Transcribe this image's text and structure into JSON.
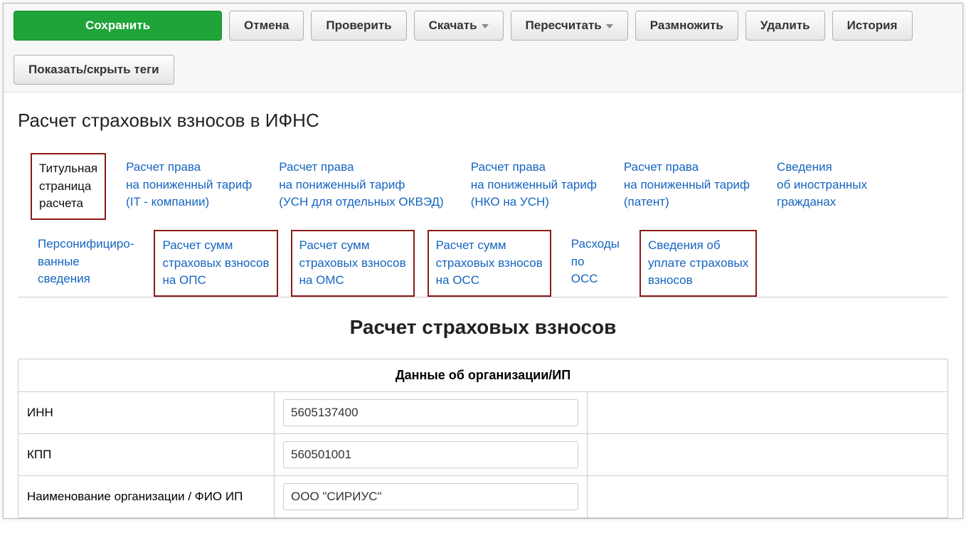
{
  "toolbar": {
    "save": "Сохранить",
    "cancel": "Отмена",
    "check": "Проверить",
    "download": "Скачать",
    "recalculate": "Пересчитать",
    "multiply": "Размножить",
    "delete": "Удалить",
    "history": "История",
    "toggle_tags": "Показать/скрыть теги"
  },
  "page_title": "Расчет страховых взносов в ИФНС",
  "tabs_row1": [
    "Титульная\nстраница\nрасчета",
    "Расчет права\nна пониженный тариф\n(IT - компании)",
    "Расчет права\nна пониженный тариф\n(УСН для отдельных ОКВЭД)",
    "Расчет права\nна пониженный тариф\n(НКО на УСН)",
    "Расчет права\nна пониженный тариф\n(патент)",
    "Сведения\nоб иностранных\nгражданах"
  ],
  "tabs_row2": [
    "Персонифициро-\nванные\nсведения",
    "Расчет сумм\nстраховых взносов\nна ОПС",
    "Расчет сумм\nстраховых взносов\nна ОМС",
    "Расчет сумм\nстраховых взносов\nна ОСС",
    "Расходы\nпо\nОСС",
    "Сведения об\nуплате страховых\nвзносов"
  ],
  "section_title": "Расчет страховых взносов",
  "form": {
    "header": "Данные об организации/ИП",
    "rows": [
      {
        "label": "ИНН",
        "value": "5605137400"
      },
      {
        "label": "КПП",
        "value": "560501001"
      },
      {
        "label": "Наименование организации / ФИО ИП",
        "value": "ООО \"СИРИУС\""
      }
    ]
  }
}
